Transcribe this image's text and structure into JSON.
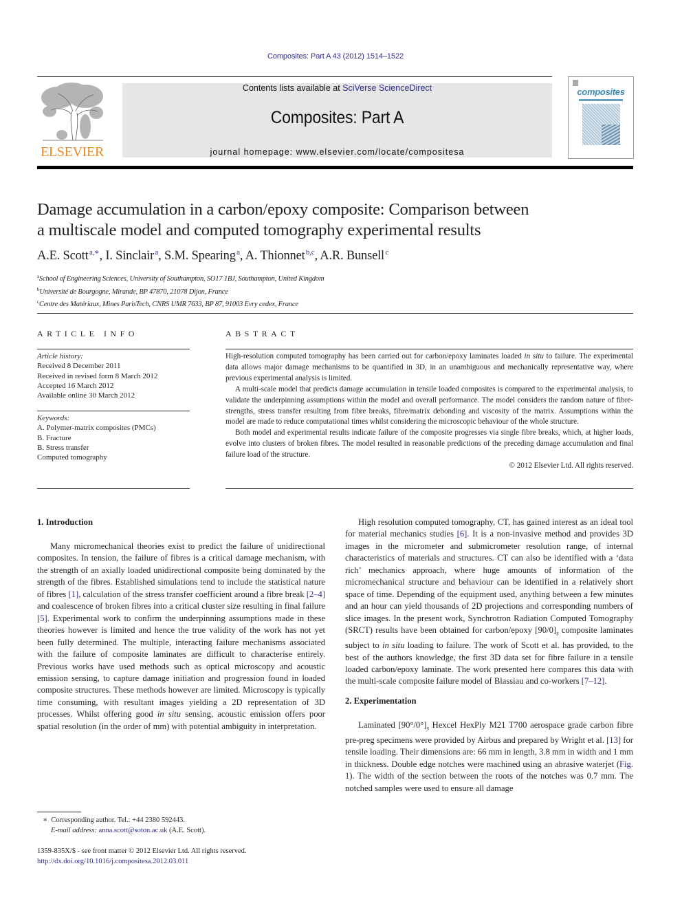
{
  "running_head": "Composites: Part A 43 (2012) 1514–1522",
  "publisher": {
    "name": "ELSEVIER",
    "logo_icon": "elsevier-tree-logo",
    "brand_color": "#f08a24"
  },
  "banner": {
    "contents_prefix": "Contents lists available at ",
    "contents_link": "SciVerse ScienceDirect",
    "journal_title": "Composites: Part A",
    "homepage": "journal homepage: www.elsevier.com/locate/compositesa",
    "background_color": "#e6e6e6"
  },
  "cover": {
    "title": "composites",
    "icon": "journal-cover-thumbnail"
  },
  "article": {
    "title_line1": "Damage accumulation in a carbon/epoxy composite: Comparison between",
    "title_line2": "a multiscale model and computed tomography experimental results",
    "authors": [
      {
        "name": "A.E. Scott",
        "sup": "a,∗"
      },
      {
        "name": "I. Sinclair",
        "sup": "a"
      },
      {
        "name": "S.M. Spearing",
        "sup": "a"
      },
      {
        "name": "A. Thionnet",
        "sup": "b,c"
      },
      {
        "name": "A.R. Bunsell",
        "sup": "c"
      }
    ],
    "affiliations": [
      {
        "mark": "a",
        "text": "School of Engineering Sciences, University of Southampton, SO17 1BJ, Southampton, United Kingdom"
      },
      {
        "mark": "b",
        "text": "Université de Bourgogne, Mirande, BP 47870, 21078 Dijon, France"
      },
      {
        "mark": "c",
        "text": "Centre des Matériaux, Mines ParisTech, CNRS UMR 7633, BP 87, 91003 Evry cedex, France"
      }
    ]
  },
  "article_info": {
    "heading": "ARTICLE INFO",
    "history_label": "Article history:",
    "history": [
      "Received 8 December 2011",
      "Received in revised form 8 March 2012",
      "Accepted 16 March 2012",
      "Available online 30 March 2012"
    ],
    "keywords_label": "Keywords:",
    "keywords": [
      "A. Polymer-matrix composites (PMCs)",
      "B. Fracture",
      "B. Stress transfer",
      "Computed tomography"
    ]
  },
  "abstract": {
    "heading": "ABSTRACT",
    "p1_a": "High-resolution computed tomography has been carried out for carbon/epoxy laminates loaded ",
    "p1_em": "in situ",
    "p1_b": " to failure. The experimental data allows major damage mechanisms to be quantified in 3D, in an unambiguous and mechanically representative way, where previous experimental analysis is limited.",
    "p2": "A multi-scale model that predicts damage accumulation in tensile loaded composites is compared to the experimental analysis, to validate the underpinning assumptions within the model and overall performance. The model considers the random nature of fibre-strengths, stress transfer resulting from fibre breaks, fibre/matrix debonding and viscosity of the matrix. Assumptions within the model are made to reduce computational times whilst considering the microscopic behaviour of the whole structure.",
    "p3": "Both model and experimental results indicate failure of the composite progresses via single fibre breaks, which, at higher loads, evolve into clusters of broken fibres. The model resulted in reasonable predictions of the preceding damage accumulation and final failure load of the structure.",
    "copyright": "© 2012 Elsevier Ltd. All rights reserved."
  },
  "introduction": {
    "heading": "1. Introduction",
    "t1": "Many micromechanical theories exist to predict the failure of unidirectional composites. In tension, the failure of fibres is a critical damage mechanism, with the strength of an axially loaded unidirectional composite being dominated by the strength of the fibres. Established simulations tend to include the statistical nature of fibres ",
    "r1": "[1]",
    "t2": ", calculation of the stress transfer coefficient around a fibre break ",
    "r2": "[2–4]",
    "t3": " and coalescence of broken fibres into a critical cluster size resulting in final failure ",
    "r3": "[5]",
    "t4": ". Experimental work to confirm the underpinning assumptions made in these theories however is limited and hence the true validity of the work has not yet been fully determined. The multiple, interacting failure mechanisms associated with the failure of composite laminates are difficult to characterise entirely. Previous works have used methods such as optical microscopy and acoustic emission sensing, to capture damage initiation and progression found in loaded composite structures. These methods however are limited. Microscopy is typically time consuming, with resultant images yielding a 2D representation of 3D processes. Whilst offering good ",
    "em1": "in situ",
    "t5": " sensing, acoustic emission offers poor spatial resolution (in the order of mm) with potential ambiguity in interpretation."
  },
  "right_column": {
    "t1": "High resolution computed tomography, CT, has gained interest as an ideal tool for material mechanics studies ",
    "r1": "[6]",
    "t2": ". It is a non-invasive method and provides 3D images in the micrometer and submicrometer resolution range, of internal characteristics of materials and structures. CT can also be identified with a ‘data rich’ mechanics approach, where huge amounts of information of the micromechanical structure and behaviour can be identified in a relatively short space of time. Depending of the equipment used, anything between a few minutes and an hour can yield thousands of 2D projections and corresponding numbers of slice images. In the present work, Synchrotron Radiation Computed Tomography (SRCT) results have been obtained for carbon/epoxy [90/0]",
    "sub1": "s",
    "t3": " composite laminates subject to ",
    "em1": "in situ",
    "t4": " loading to failure. The work of Scott et al. has provided, to the best of the authors knowledge, the first 3D data set for fibre failure in a tensile loaded carbon/epoxy laminate. The work presented here compares this data with the multi-scale composite failure model of Blassiau and co-workers ",
    "r2": "[7–12]",
    "t5": "."
  },
  "experimentation": {
    "heading": "2. Experimentation",
    "t1": "Laminated [90°/0°]",
    "sub1": "s",
    "t2": " Hexcel HexPly M21 T700 aerospace grade carbon fibre pre-preg specimens were provided by Airbus and prepared by Wright et al. ",
    "r1": "[13]",
    "t3": " for tensile loading. Their dimensions are: 66 mm in length, 3.8 mm in width and 1 mm in thickness. Double edge notches were machined using an abrasive waterjet (",
    "fig": "Fig. 1",
    "t4": "). The width of the section between the roots of the notches was 0.7 mm. The notched samples were used to ensure all damage"
  },
  "footnote": {
    "mark": "∗",
    "corresponding": "Corresponding author. Tel.: +44 2380 592443.",
    "email_label": "E-mail address:",
    "email": "anna.scott@soton.ac.uk",
    "email_suffix": " (A.E. Scott)."
  },
  "issn": {
    "line": "1359-835X/$ - see front matter © 2012 Elsevier Ltd. All rights reserved.",
    "doi": "http://dx.doi.org/10.1016/j.compositesa.2012.03.011"
  },
  "colors": {
    "link": "#2c2c8c",
    "text": "#231f20"
  }
}
